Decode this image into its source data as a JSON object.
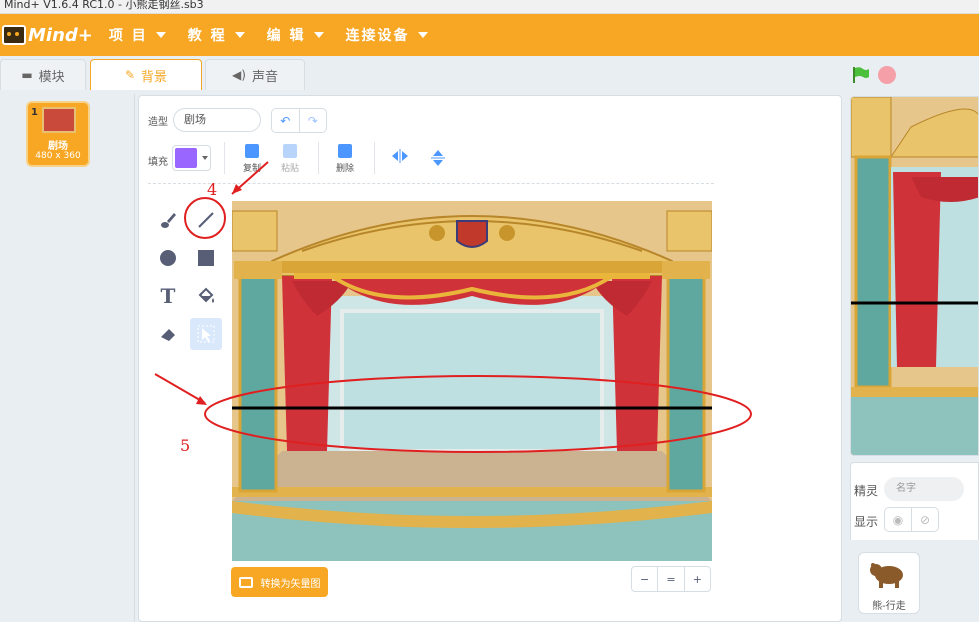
{
  "window": {
    "title": "Mind+ V1.6.4 RC1.0 - 小熊走钢丝.sb3"
  },
  "menubar": {
    "logo": "Mind+",
    "items": [
      {
        "label": "项 目"
      },
      {
        "label": "教 程"
      },
      {
        "label": "编 辑"
      },
      {
        "label": "连接设备"
      }
    ],
    "color": "#f7a724"
  },
  "tabs": [
    {
      "label": "模块",
      "icon": "blocks-icon"
    },
    {
      "label": "背景",
      "icon": "brush-icon",
      "active": true
    },
    {
      "label": "声音",
      "icon": "speaker-icon"
    }
  ],
  "backdrops": [
    {
      "index": "1",
      "name": "剧场",
      "size": "480 x 360"
    }
  ],
  "editor": {
    "costume_label": "造型",
    "costume_name": "剧场",
    "fill_label": "填充",
    "fill_color": "#9966ff",
    "toolbar": {
      "copy": "复制",
      "paste": "粘贴",
      "delete": "删除"
    },
    "convert_button": "转换为矢量图",
    "zoom": {
      "out": "−",
      "reset": "=",
      "in": "+"
    }
  },
  "sprite_panel": {
    "sprite_label": "精灵",
    "name_placeholder": "名字",
    "show_label": "显示",
    "sprites": [
      {
        "name": "熊-行走"
      }
    ]
  },
  "annotations": {
    "step4": "4",
    "step5": "5"
  }
}
